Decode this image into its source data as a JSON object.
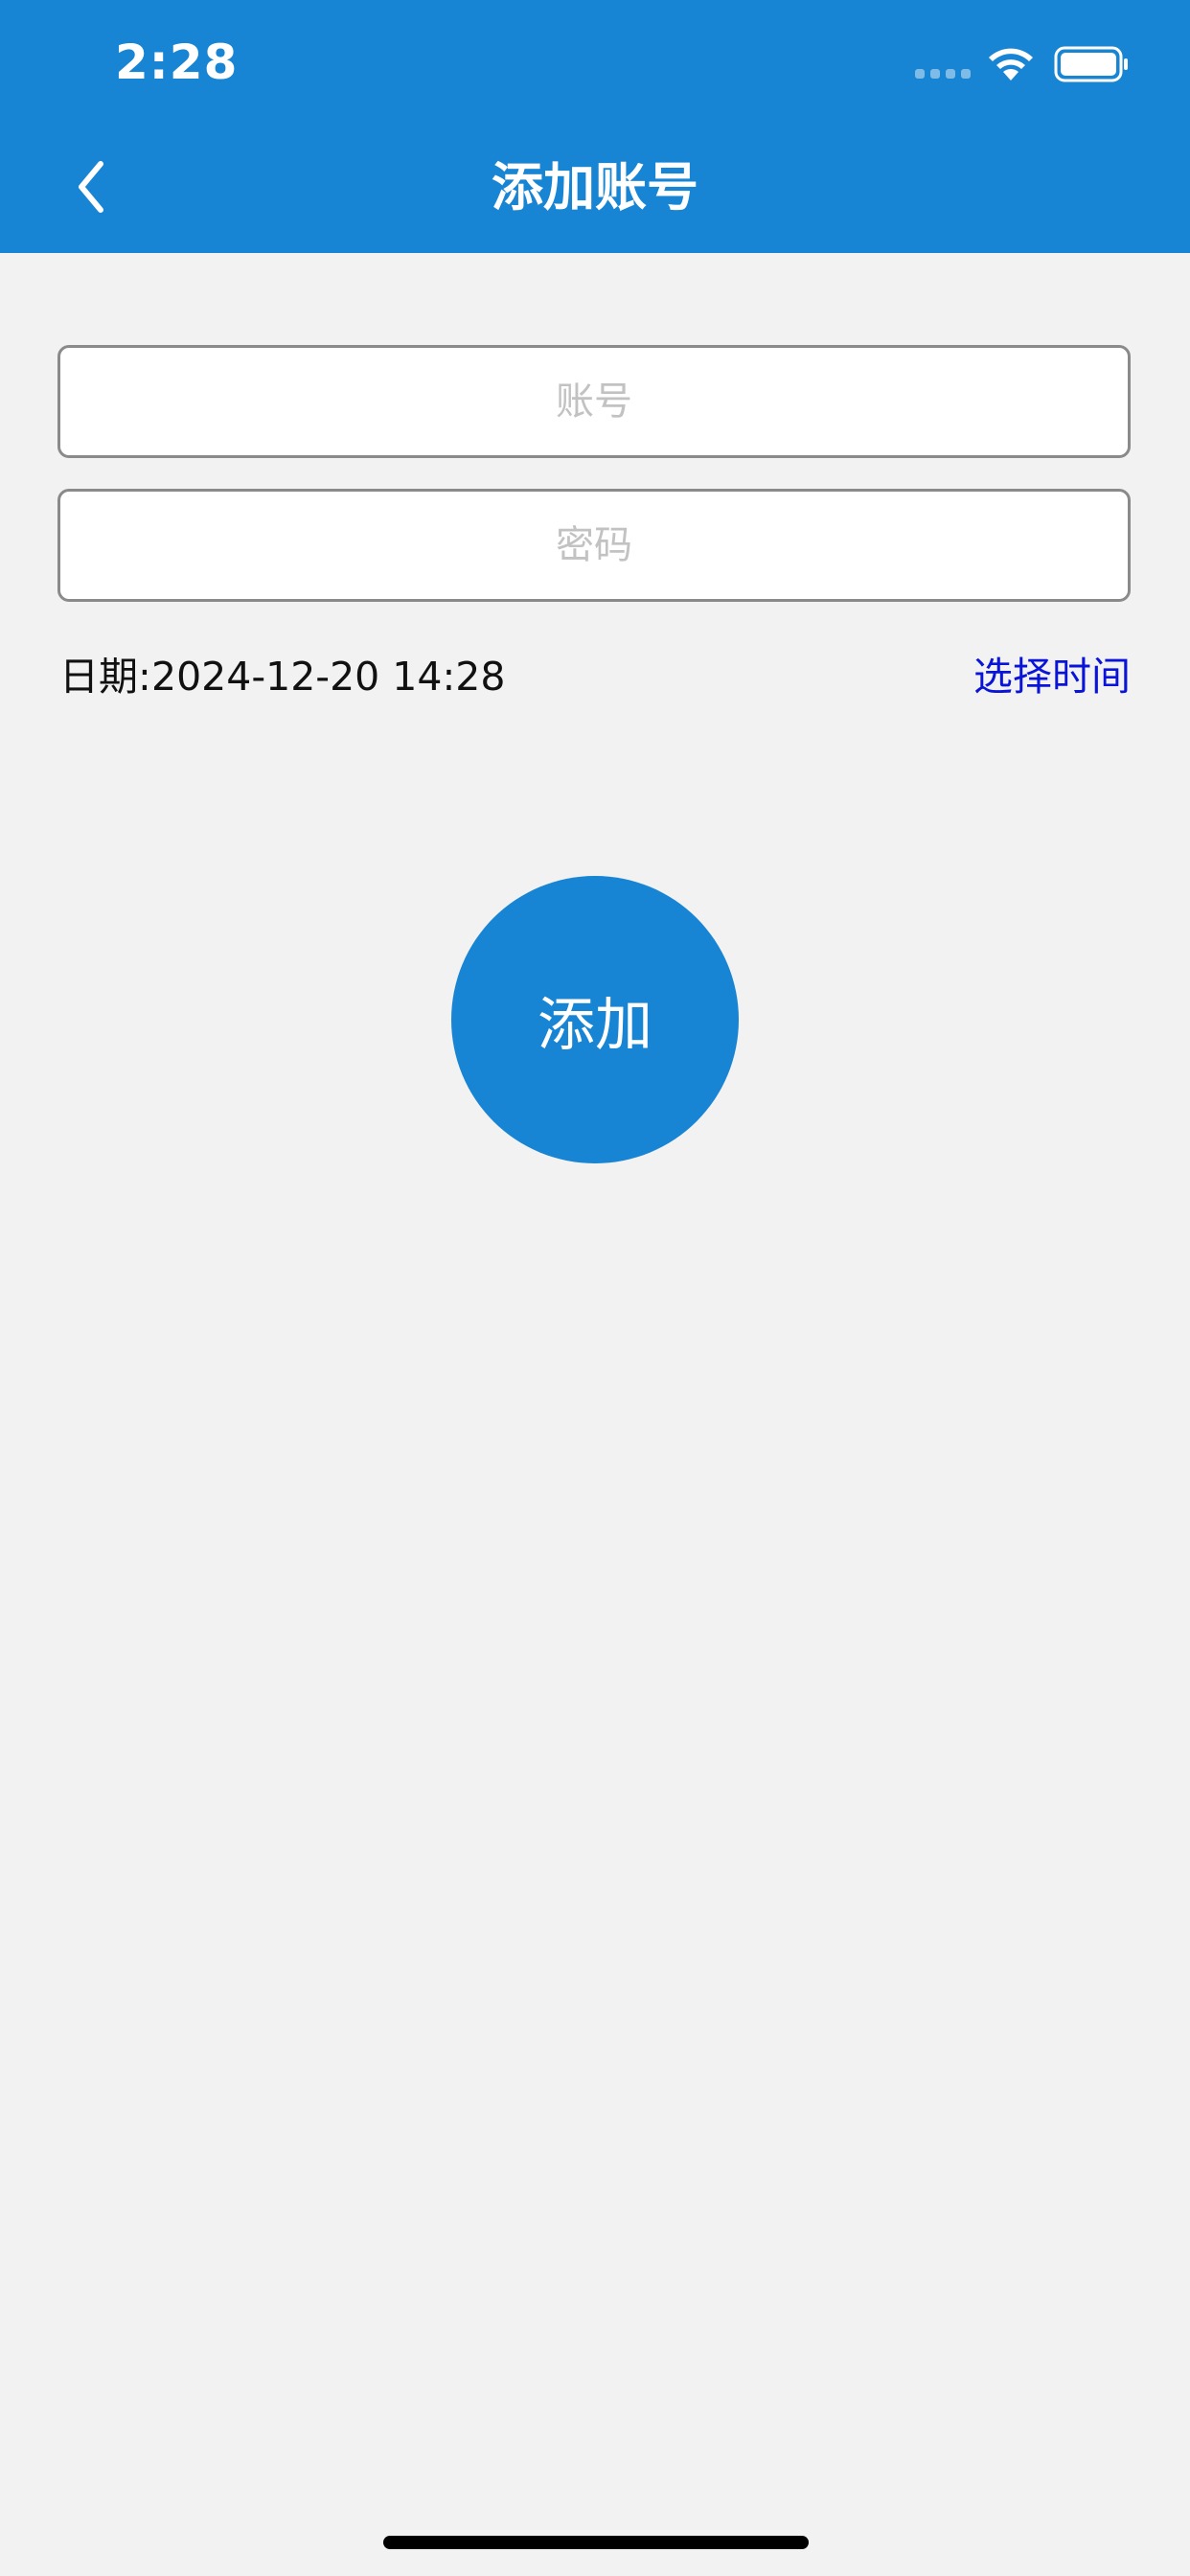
{
  "status_bar": {
    "time": "2:28"
  },
  "nav": {
    "title": "添加账号"
  },
  "form": {
    "account_placeholder": "账号",
    "password_placeholder": "密码",
    "date_label": "日期:",
    "date_value": "2024-12-20 14:28",
    "pick_time_label": "选择时间",
    "add_button_label": "添加"
  },
  "colors": {
    "header": "#1784d4",
    "link": "#0a14d8",
    "background": "#f2f2f2"
  },
  "icons": {
    "back": "chevron-left-icon",
    "wifi": "wifi-icon",
    "battery": "battery-icon"
  }
}
